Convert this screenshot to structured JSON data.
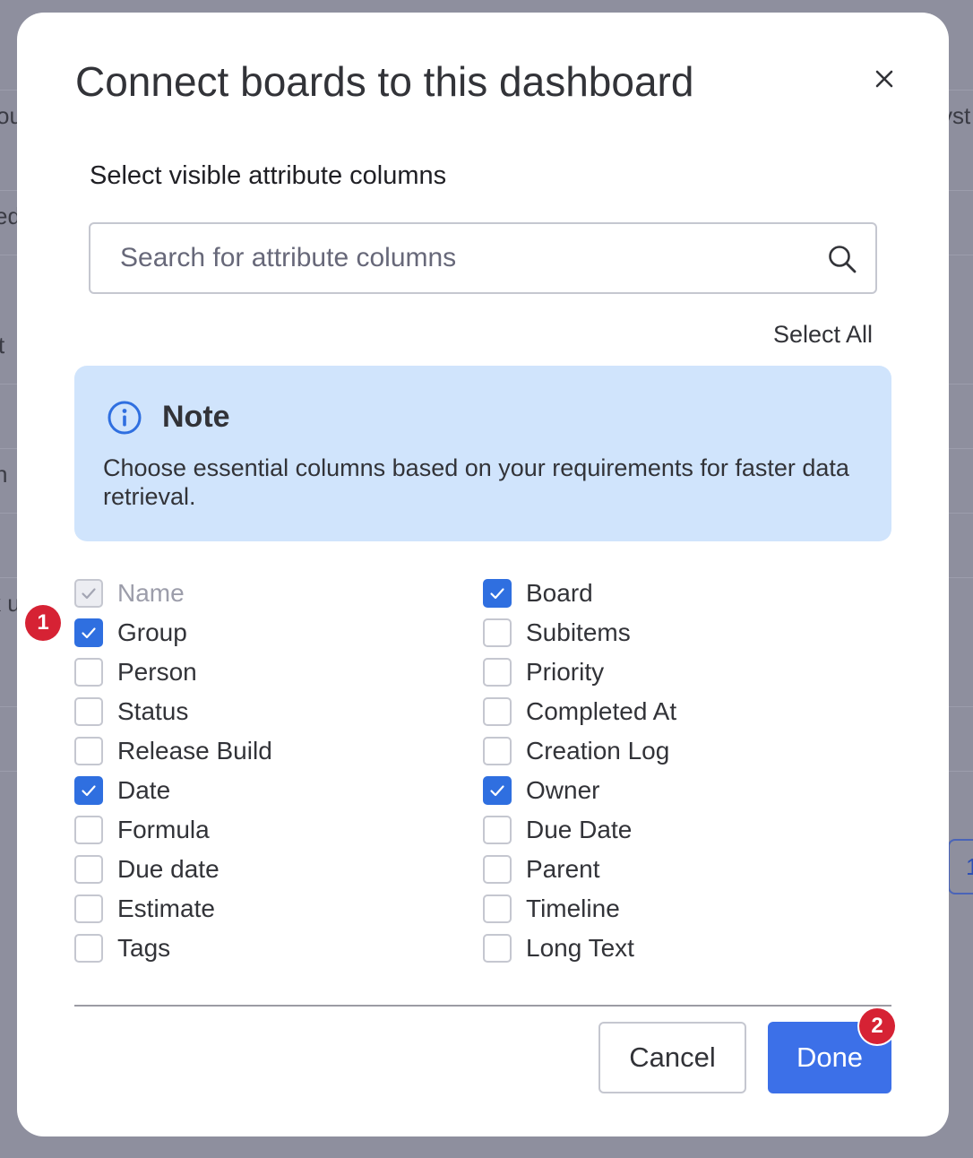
{
  "background": {
    "fragments": [
      "ou",
      "ed",
      "t",
      "n",
      "k u",
      "yst",
      "1"
    ]
  },
  "modal": {
    "title": "Connect boards to this dashboard",
    "close_icon": "close-icon",
    "subtitle": "Select visible attribute columns",
    "search": {
      "placeholder": "Search for attribute columns",
      "value": "",
      "icon": "search-icon"
    },
    "select_all_label": "Select All",
    "note": {
      "icon": "info-icon",
      "title": "Note",
      "text": "Choose essential columns based on your requirements for faster data retrieval."
    },
    "columns_left": [
      {
        "label": "Name",
        "checked": true,
        "disabled": true
      },
      {
        "label": "Group",
        "checked": true,
        "disabled": false
      },
      {
        "label": "Person",
        "checked": false,
        "disabled": false
      },
      {
        "label": "Status",
        "checked": false,
        "disabled": false
      },
      {
        "label": "Release Build",
        "checked": false,
        "disabled": false
      },
      {
        "label": "Date",
        "checked": true,
        "disabled": false
      },
      {
        "label": "Formula",
        "checked": false,
        "disabled": false
      },
      {
        "label": "Due date",
        "checked": false,
        "disabled": false
      },
      {
        "label": "Estimate",
        "checked": false,
        "disabled": false
      },
      {
        "label": "Tags",
        "checked": false,
        "disabled": false
      }
    ],
    "columns_right": [
      {
        "label": "Board",
        "checked": true,
        "disabled": false
      },
      {
        "label": "Subitems",
        "checked": false,
        "disabled": false
      },
      {
        "label": "Priority",
        "checked": false,
        "disabled": false
      },
      {
        "label": "Completed At",
        "checked": false,
        "disabled": false
      },
      {
        "label": "Creation Log",
        "checked": false,
        "disabled": false
      },
      {
        "label": "Owner",
        "checked": true,
        "disabled": false
      },
      {
        "label": "Due Date",
        "checked": false,
        "disabled": false
      },
      {
        "label": "Parent",
        "checked": false,
        "disabled": false
      },
      {
        "label": "Timeline",
        "checked": false,
        "disabled": false
      },
      {
        "label": "Long Text",
        "checked": false,
        "disabled": false
      }
    ],
    "buttons": {
      "cancel_label": "Cancel",
      "done_label": "Done"
    }
  },
  "annotations": {
    "badge_1": "1",
    "badge_2": "2"
  },
  "colors": {
    "accent": "#3c70e8",
    "checkbox_checked": "#2f6fe0",
    "note_background": "#d0e4fc",
    "badge": "#d62234",
    "overlay": "#8e8f9e"
  }
}
